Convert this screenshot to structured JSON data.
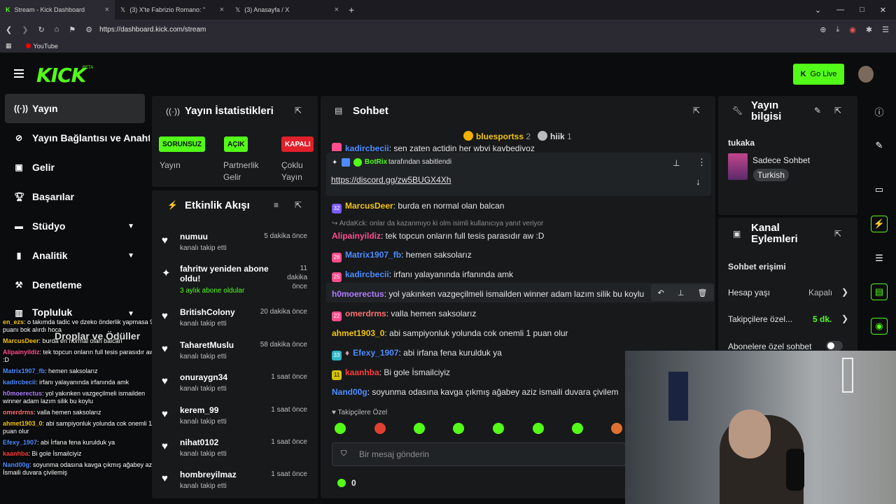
{
  "browser": {
    "tabs": [
      {
        "title": "Stream - Kick Dashboard",
        "close": "×"
      },
      {
        "title": "(3) X'te Fabrizio Romano: \"",
        "close": "×"
      },
      {
        "title": "(3) Anasayfa / X",
        "close": "×"
      }
    ],
    "new_tab": "+",
    "url": "https://dashboard.kick.com/stream",
    "bookmark": "YouTube"
  },
  "header": {
    "logo": "KICK",
    "beta": "BETA",
    "go_live": "Go Live"
  },
  "nav": {
    "items": [
      {
        "label": "Yayın",
        "icon": "broadcast-icon"
      },
      {
        "label": "Yayın Bağlantısı ve Anahtar",
        "icon": "link-icon"
      },
      {
        "label": "Gelir",
        "icon": "revenue-icon"
      },
      {
        "label": "Başarılar",
        "icon": "trophy-icon"
      },
      {
        "label": "Stüdyo",
        "icon": "studio-icon"
      },
      {
        "label": "Analitik",
        "icon": "chart-icon"
      },
      {
        "label": "Denetleme",
        "icon": "hammer-icon"
      },
      {
        "label": "Topluluk",
        "icon": "community-icon"
      },
      {
        "label": "Droplar ve Ödüller",
        "icon": "gift-icon"
      }
    ]
  },
  "overlay_chat": [
    {
      "user": "en_ezs",
      "text": ": o takımda tadic ve dzeko önderlik yapmasa 99 puanı bok alırdı hoca",
      "color": "#f1c40f"
    },
    {
      "user": "MarcusDeer",
      "text": ": burda en normal olan balcan",
      "color": "#f1c40f"
    },
    {
      "user": "Alipainyildiz",
      "text": ": tek topcun onların full tesis parasıdır aw :D",
      "color": "#ff4d8d"
    },
    {
      "user": "Matrix1907_fb",
      "text": ": hemen saksolarız",
      "color": "#4d8cff"
    },
    {
      "user": "kadircbecii",
      "text": ": irfanı yalayanında irfanında amk",
      "color": "#4d8cff"
    },
    {
      "user": "h0moerectus",
      "text": ": yol yakınken vazgeçilmeli ismailden winner adam lazım silik bu koylu",
      "color": "#b07cff"
    },
    {
      "user": "omerdrms",
      "text": ": valla hemen saksolarız",
      "color": "#ff6f6f"
    },
    {
      "user": "ahmet1903_0",
      "text": ": abi sampiyonluk yolunda cok onemli 1 puan olur",
      "color": "#f1c40f"
    },
    {
      "user": "Efexy_1907",
      "text": ": abi İrfana fena kurulduk ya",
      "color": "#4d8cff"
    },
    {
      "user": "kaanhba",
      "text": ": Bi gole İsmailciyiz",
      "color": "#ff3b3b"
    },
    {
      "user": "Nand00g",
      "text": ": soyunma odasına kavga çıkmış ağabey aziz İsmaili duvara çivilemiş",
      "color": "#4d8cff"
    }
  ],
  "stats": {
    "title": "Yayın İstatistikleri",
    "items": [
      {
        "badge": "SORUNSUZ",
        "label": "Yayın",
        "color": "#53fc18",
        "text_color": "#0b0c0d"
      },
      {
        "badge": "AÇIK",
        "label": "Partnerlik Gelir",
        "color": "#53fc18",
        "text_color": "#0b0c0d"
      },
      {
        "badge": "KAPALI",
        "label": "Çoklu Yayın",
        "color": "#e0202a",
        "text_color": "#ffffff"
      }
    ]
  },
  "activity": {
    "title": "Etkinlik Akışı",
    "items": [
      {
        "name": "numuu",
        "sub": "kanalı takip etti",
        "time": "5 dakika önce",
        "icon": "heart-icon"
      },
      {
        "name": "fahritw yeniden abone oldu!",
        "sub": "3 aylık abone oldular",
        "time": "11 dakika önce",
        "icon": "sparkle-icon"
      },
      {
        "name": "BritishColony",
        "sub": "kanalı takip etti",
        "time": "20 dakika önce",
        "icon": "heart-icon"
      },
      {
        "name": "TaharetMuslu",
        "sub": "kanalı takip etti",
        "time": "58 dakika önce",
        "icon": "heart-icon"
      },
      {
        "name": "onuraygn34",
        "sub": "kanalı takip etti",
        "time": "1 saat önce",
        "icon": "heart-icon"
      },
      {
        "name": "kerem_99",
        "sub": "kanalı takip etti",
        "time": "1 saat önce",
        "icon": "heart-icon"
      },
      {
        "name": "nihat0102",
        "sub": "kanalı takip etti",
        "time": "1 saat önce",
        "icon": "heart-icon"
      },
      {
        "name": "hombreyilmaz",
        "sub": "kanalı takip etti",
        "time": "1 saat önce",
        "icon": "heart-icon"
      }
    ]
  },
  "chat": {
    "title": "Sohbet",
    "top_gifters": [
      {
        "name": "bluesportss",
        "count": "2"
      },
      {
        "name": "hiik",
        "count": "1"
      }
    ],
    "prev_line_user": "kadircbecii",
    "prev_line_text": ": sen zaten actidin her wbyi kaybediyoz",
    "pinned_by": "BotRix",
    "pinned_suffix": "tarafından sabitlendi",
    "pinned_link": "https://discord.gg/zw5BUGX4Xh",
    "reply_line": "ArdaKck: onlar da kazanmıyo ki olm isimli kullanıcıya yanıt veriyor",
    "messages": [
      {
        "badge": "32",
        "badge_color": "#7b5cff",
        "user": "MarcusDeer",
        "user_color": "#f1c40f",
        "text": ": burda en normal olan balcan"
      },
      {
        "badge": "",
        "badge_color": "",
        "user": "Alipainyildiz",
        "user_color": "#ff4d8d",
        "text": ": tek topcun onların full tesis parasıdır aw :D"
      },
      {
        "badge": "26",
        "badge_color": "#ff4d8d",
        "user": "Matrix1907_fb",
        "user_color": "#4d8cff",
        "text": ": hemen saksolarız"
      },
      {
        "badge": "25",
        "badge_color": "#ff4d8d",
        "user": "kadircbecii",
        "user_color": "#4d8cff",
        "text": ": irfanı yalayanında irfanında amk"
      },
      {
        "badge": "",
        "badge_color": "",
        "user": "h0moerectus",
        "user_color": "#b07cff",
        "text": ": yol yakınken vazgeçilmeli ismailden winner adam lazım silik bu koylu"
      },
      {
        "badge": "22",
        "badge_color": "#ff4d8d",
        "user": "omerdrms",
        "user_color": "#ff6f6f",
        "text": ": valla hemen saksolarız"
      },
      {
        "badge": "",
        "badge_color": "",
        "user": "ahmet1903_0",
        "user_color": "#f1c40f",
        "text": ": abi sampiyonluk yolunda cok onemli 1 puan olur"
      },
      {
        "badge": "33",
        "badge_color": "#2fb7c7",
        "user": "Efexy_1907",
        "user_color": "#4d8cff",
        "text": ": abi irfana fena kurulduk ya"
      },
      {
        "badge": "11",
        "badge_color": "#d7c400",
        "user": "kaanhba",
        "user_color": "#ff3b3b",
        "text": ": Bi gole İsmailciyiz"
      },
      {
        "badge": "",
        "badge_color": "",
        "user": "Nand00g",
        "user_color": "#4d8cff",
        "text": ": soyunma odasına kavga çıkmış ağabey aziz ismaili duvara çivilem"
      }
    ],
    "emote_label": "Takipçilere Özel",
    "input_placeholder": "Bir mesaj gönderin",
    "points": "0"
  },
  "info": {
    "title": "Yayın bilgisi",
    "channel": "tukaka",
    "category": "Sadece Sohbet",
    "language": "Turkish"
  },
  "channel_actions": {
    "title": "Kanal Eylemleri",
    "section": "Sohbet erişimi",
    "rows": [
      {
        "label": "Hesap yaşı",
        "value": "Kapalı",
        "value_color": "#bdbdbd"
      },
      {
        "label": "Takipçilere özel...",
        "value": "5 dk.",
        "value_color": "#53fc18"
      },
      {
        "label": "Abonelere özel sohbet",
        "value": "",
        "value_color": ""
      }
    ]
  },
  "colors": {
    "accent": "#53fc18",
    "panel": "#17191b",
    "bg": "#0b0c0d"
  }
}
